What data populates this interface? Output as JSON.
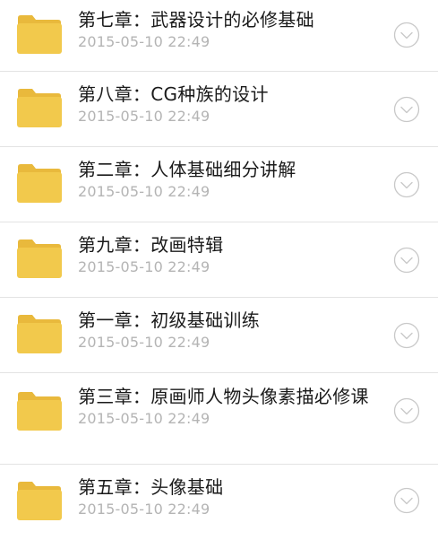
{
  "items": [
    {
      "title": "第七章：武器设计的必修基础",
      "date": "2015-05-10 22:49"
    },
    {
      "title": "第八章：CG种族的设计",
      "date": "2015-05-10 22:49"
    },
    {
      "title": "第二章：人体基础细分讲解",
      "date": "2015-05-10 22:49"
    },
    {
      "title": "第九章：改画特辑",
      "date": "2015-05-10 22:49"
    },
    {
      "title": "第一章：初级基础训练",
      "date": "2015-05-10 22:49"
    },
    {
      "title": "第三章：原画师人物头像素描必修课",
      "date": "2015-05-10 22:49"
    },
    {
      "title": "第五章：头像基础",
      "date": "2015-05-10 22:49"
    }
  ],
  "icons": {
    "folder": "folder-icon",
    "expand": "chevron-down-circle-icon"
  },
  "colors": {
    "folder_body": "#F2C94C",
    "folder_tab": "#E9B93C",
    "title_text": "#1A1A1A",
    "date_text": "#B4B4B4",
    "chevron": "#C8C8C8",
    "divider": "#E3E3E3"
  }
}
